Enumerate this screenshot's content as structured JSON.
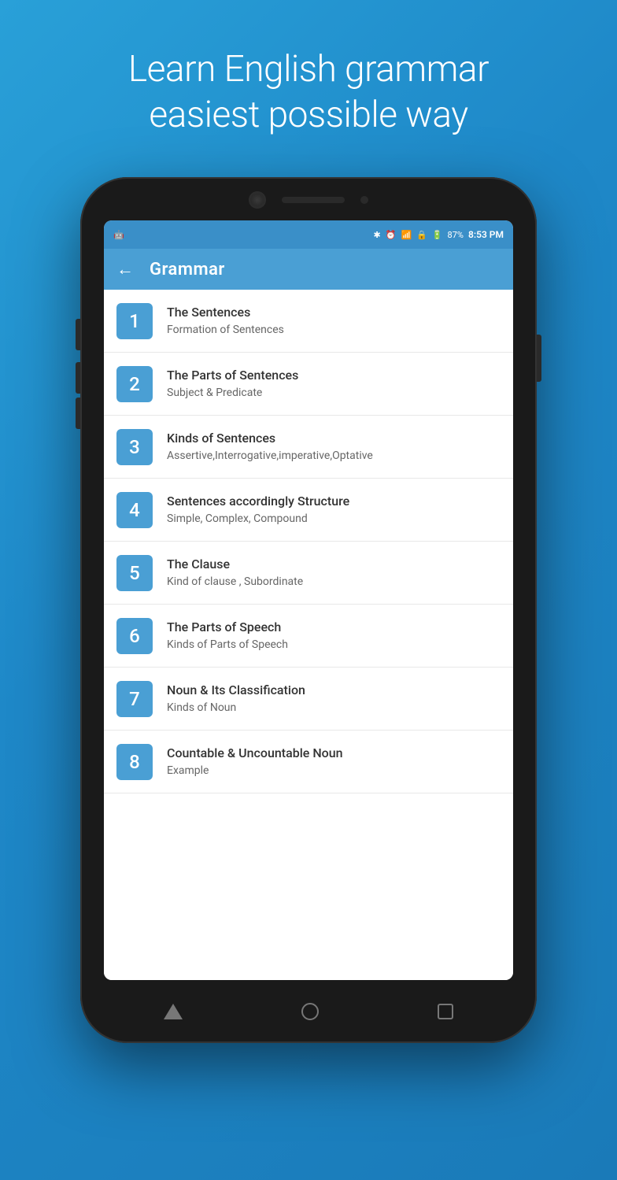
{
  "hero": {
    "line1": "Learn English grammar",
    "line2": "easiest possible way"
  },
  "statusBar": {
    "battery": "87%",
    "time": "8:53 PM"
  },
  "appBar": {
    "title": "Grammar",
    "backLabel": "←"
  },
  "listItems": [
    {
      "number": "1",
      "title": "The Sentences",
      "subtitle": "Formation of Sentences"
    },
    {
      "number": "2",
      "title": "The Parts of Sentences",
      "subtitle": "Subject & Predicate"
    },
    {
      "number": "3",
      "title": "Kinds of Sentences",
      "subtitle": "Assertive,Interrogative,imperative,Optative"
    },
    {
      "number": "4",
      "title": "Sentences accordingly Structure",
      "subtitle": "Simple, Complex, Compound"
    },
    {
      "number": "5",
      "title": "The Clause",
      "subtitle": "Kind of clause , Subordinate"
    },
    {
      "number": "6",
      "title": "The Parts of Speech",
      "subtitle": "Kinds of Parts of Speech"
    },
    {
      "number": "7",
      "title": "Noun & Its Classification",
      "subtitle": "Kinds of Noun"
    },
    {
      "number": "8",
      "title": "Countable & Uncountable Noun",
      "subtitle": "Example"
    }
  ]
}
